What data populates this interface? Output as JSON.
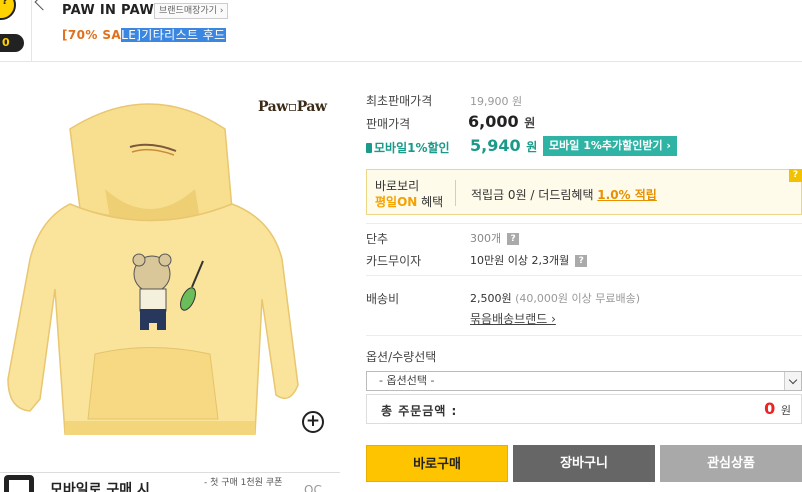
{
  "header": {
    "badge_text": "0",
    "coin_mark": "?",
    "brand_name": "PAW IN PAW",
    "brand_shop_button": "브랜드매장가기 ›",
    "title_prefix": "[70% SA",
    "title_highlight": "LE]기타리스트 후드"
  },
  "image": {
    "brand_logo": "Paw▫Paw",
    "zoom_icon": "+"
  },
  "promo": {
    "headline": "모바일로 구매 시",
    "sub": "- 첫 구매 1천원 쿠폰",
    "tail": "OC"
  },
  "pricing": {
    "orig_label": "최초판매가격",
    "orig_value": "19,900 원",
    "sale_label": "판매가격",
    "sale_value": "6,000",
    "won": "원",
    "mobile_label": "모바일1%할인",
    "mobile_value": "5,940",
    "mobile_button": "모바일 1%추가할인받기 ›"
  },
  "benefit": {
    "line1": "바로보리",
    "line2_on": "평일ON",
    "line2_rest": " 혜택",
    "points_text": "적립금 0원 / 더드림혜택 ",
    "points_pct": "1.0% 적립",
    "help_icon": "?"
  },
  "details": {
    "unit_label": "단추",
    "unit_value": "300개",
    "card_label": "카드무이자",
    "card_value": "10만원 이상 2,3개월",
    "shipping_label": "배송비",
    "shipping_value": "2,500원",
    "shipping_note": "(40,000원 이상 무료배송)",
    "bundle_link": "묶음배송브랜드 ›",
    "help_icon": "?"
  },
  "options": {
    "label": "옵션/수량선택",
    "select_value": "- 옵션선택 -",
    "total_label": "총 주문금액 :",
    "total_value": "0",
    "total_won": "원"
  },
  "actions": {
    "buy": "바로구매",
    "cart": "장바구니",
    "wish": "관심상품"
  },
  "colors": {
    "accent_orange": "#e0701b",
    "mobile_teal": "#1a9a8a",
    "buy_yellow": "#ffc400",
    "total_red": "#ee2222"
  }
}
